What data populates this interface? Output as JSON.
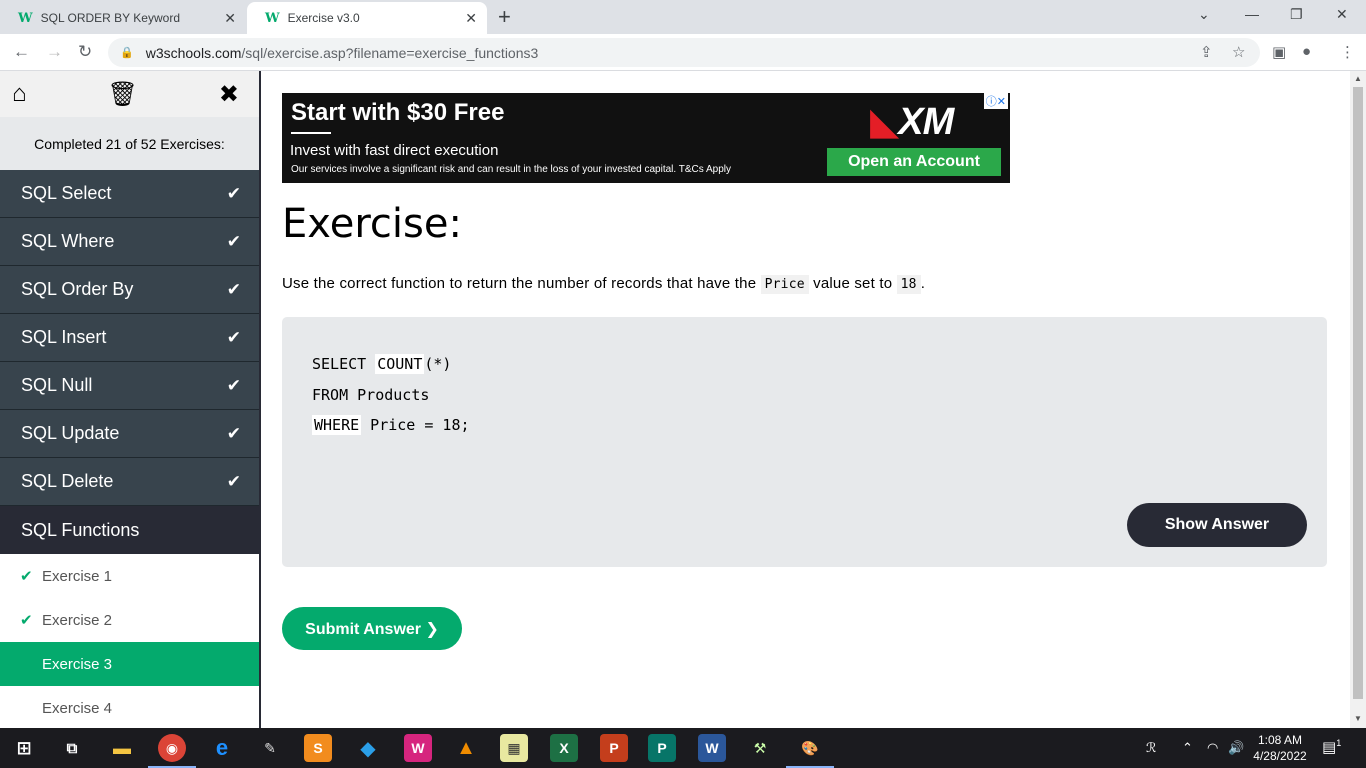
{
  "browser": {
    "tabs": [
      {
        "title": "SQL ORDER BY Keyword",
        "favicon": "W3"
      },
      {
        "title": "Exercise v3.0",
        "favicon": "W3"
      }
    ],
    "url_host": "w3schools.com",
    "url_path": "/sql/exercise.asp?filename=exercise_functions3"
  },
  "sidebar": {
    "completed_text": "Completed 21 of 52 Exercises:",
    "categories": [
      {
        "label": "SQL Select",
        "done": true
      },
      {
        "label": "SQL Where",
        "done": true
      },
      {
        "label": "SQL Order By",
        "done": true
      },
      {
        "label": "SQL Insert",
        "done": true
      },
      {
        "label": "SQL Null",
        "done": true
      },
      {
        "label": "SQL Update",
        "done": true
      },
      {
        "label": "SQL Delete",
        "done": true
      },
      {
        "label": "SQL Functions",
        "done": false
      }
    ],
    "exercises": [
      {
        "label": "Exercise 1",
        "done": true
      },
      {
        "label": "Exercise 2",
        "done": true
      },
      {
        "label": "Exercise 3",
        "current": true
      },
      {
        "label": "Exercise 4"
      }
    ]
  },
  "ad": {
    "headline": "Start with $30 Free",
    "subline": "Invest with fast direct execution",
    "fineprint": "Our services involve a significant risk and can result in the loss of your invested capital. T&Cs Apply",
    "cta": "Open an Account",
    "brand": "XM"
  },
  "exercise": {
    "heading": "Exercise:",
    "instruction_pre": "Use the correct function to return the number of records that have the ",
    "instruction_code1": "Price",
    "instruction_mid": " value set to ",
    "instruction_code2": "18",
    "instruction_post": ".",
    "code_line1_kw": "SELECT ",
    "code_line1_field": "COUNT",
    "code_line1_rest": "(*)",
    "code_line2": "FROM Products",
    "code_line3_field": "WHERE",
    "code_line3_rest": " Price = 18;",
    "show_answer": "Show Answer",
    "submit": "Submit Answer ❯"
  },
  "taskbar": {
    "time": "1:08 AM",
    "date": "4/28/2022",
    "notifications": "1"
  },
  "colors": {
    "accent": "#04aa6d",
    "sidebar_dark": "#38444d",
    "code_bg": "#e7e9eb",
    "dark_button": "#282a35"
  }
}
